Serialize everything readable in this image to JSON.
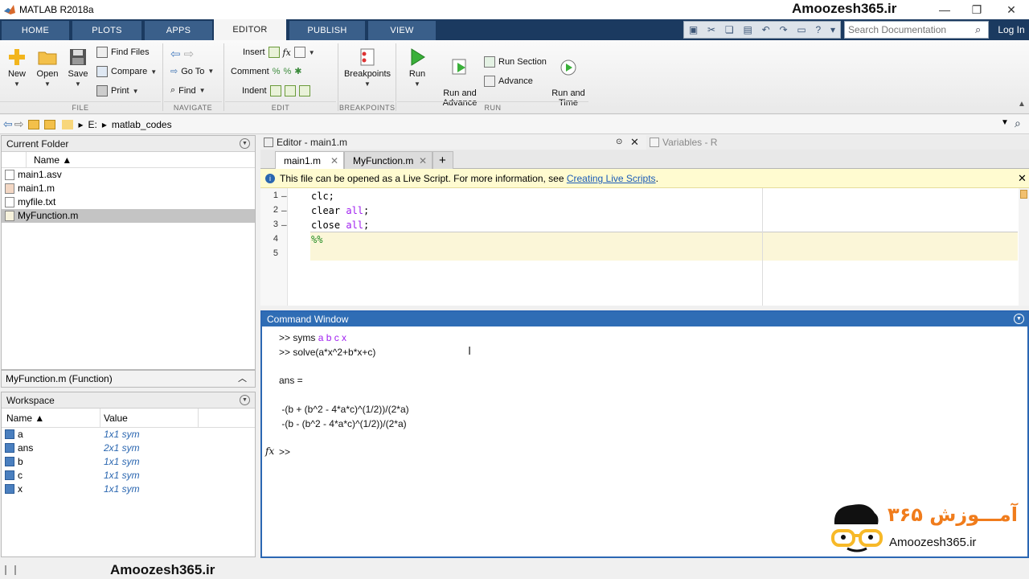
{
  "window": {
    "title": "MATLAB R2018a"
  },
  "watermark": {
    "top": "Amoozesh365.ir",
    "bottom": "Amoozesh365.ir",
    "logo_site": "Amoozesh365.ir",
    "logo_fa": "آمـــوزش ۳۶۵"
  },
  "tabs": [
    "HOME",
    "PLOTS",
    "APPS",
    "EDITOR",
    "PUBLISH",
    "VIEW"
  ],
  "active_tab": "EDITOR",
  "search": {
    "placeholder": "Search Documentation"
  },
  "login_label": "Log In",
  "ribbon": {
    "file": {
      "new": "New",
      "open": "Open",
      "save": "Save",
      "find_files": "Find Files",
      "compare": "Compare",
      "print": "Print",
      "group": "FILE"
    },
    "navigate": {
      "goto": "Go To",
      "find": "Find",
      "group": "NAVIGATE"
    },
    "edit": {
      "insert": "Insert",
      "comment": "Comment",
      "indent": "Indent",
      "group": "EDIT"
    },
    "breakpoints": {
      "label": "Breakpoints",
      "group": "BREAKPOINTS"
    },
    "run": {
      "run": "Run",
      "run_advance": "Run and\nAdvance",
      "run_section": "Run Section",
      "advance": "Advance",
      "run_time": "Run and\nTime",
      "group": "RUN"
    }
  },
  "address": {
    "drive": "E:",
    "folder": "matlab_codes"
  },
  "current_folder": {
    "title": "Current Folder",
    "col_name": "Name ▲",
    "files": [
      {
        "name": "main1.asv",
        "kind": "asv"
      },
      {
        "name": "main1.m",
        "kind": "m"
      },
      {
        "name": "myfile.txt",
        "kind": "txt"
      },
      {
        "name": "MyFunction.m",
        "kind": "fn"
      }
    ],
    "details": "MyFunction.m  (Function)"
  },
  "workspace": {
    "title": "Workspace",
    "col_name": "Name ▲",
    "col_value": "Value",
    "vars": [
      {
        "name": "a",
        "value": "1x1 sym"
      },
      {
        "name": "ans",
        "value": "2x1 sym"
      },
      {
        "name": "b",
        "value": "1x1 sym"
      },
      {
        "name": "c",
        "value": "1x1 sym"
      },
      {
        "name": "x",
        "value": "1x1 sym"
      }
    ]
  },
  "editor": {
    "title": "Editor - main1.m",
    "variables_title": "Variables - R",
    "tabs": [
      "main1.m",
      "MyFunction.m"
    ],
    "info_text": "This file can be opened as a Live Script. For more information, see ",
    "info_link": "Creating Live Scripts",
    "info_end": ".",
    "lines": [
      {
        "num": "1",
        "dash": "—",
        "a": "clc;",
        "kw": "",
        "b": ""
      },
      {
        "num": "2",
        "dash": "—",
        "a": "clear ",
        "kw": "all",
        "b": ";"
      },
      {
        "num": "3",
        "dash": "—",
        "a": "close ",
        "kw": "all",
        "b": ";"
      },
      {
        "num": "4",
        "dash": "",
        "a": "",
        "kw": "",
        "b": "",
        "comment": "%%"
      },
      {
        "num": "5",
        "dash": "",
        "a": "",
        "kw": "",
        "b": ""
      }
    ]
  },
  "command_window": {
    "title": "Command Window",
    "lines": [
      {
        "prompt": ">> syms ",
        "sym": "a b c x"
      },
      {
        "prompt": ">> solve(a*x^2+b*x+c)",
        "sym": ""
      },
      {
        "prompt": "ans =",
        "sym": ""
      },
      {
        "prompt": " -(b + (b^2 - 4*a*c)^(1/2))/(2*a)",
        "sym": ""
      },
      {
        "prompt": " -(b - (b^2 - 4*a*c)^(1/2))/(2*a)",
        "sym": ""
      }
    ],
    "fx": "fx",
    "current_prompt": ">>"
  }
}
